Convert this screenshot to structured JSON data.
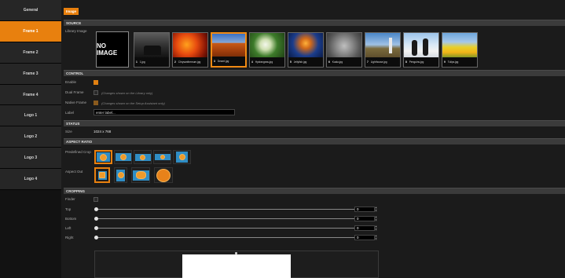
{
  "sidebar": {
    "items": [
      {
        "label": "General",
        "active": false
      },
      {
        "label": "Frame 1",
        "active": true
      },
      {
        "label": "Frame 2",
        "active": false
      },
      {
        "label": "Frame 3",
        "active": false
      },
      {
        "label": "Frame 4",
        "active": false
      },
      {
        "label": "Logo 1",
        "active": false
      },
      {
        "label": "Logo 2",
        "active": false
      },
      {
        "label": "Logo 3",
        "active": false
      },
      {
        "label": "Logo 4",
        "active": false
      }
    ]
  },
  "tab": {
    "label": "Image"
  },
  "source": {
    "header": "SOURCE",
    "library_label": "Library Image",
    "no_image": "NO IMAGE",
    "thumbs": [
      {
        "num": "1",
        "name": "1.jpg"
      },
      {
        "num": "2",
        "name": "Chrysanthemum.jpg"
      },
      {
        "num": "3",
        "name": "Desert.jpg"
      },
      {
        "num": "4",
        "name": "Hydrangeas.jpg"
      },
      {
        "num": "5",
        "name": "Jellyfish.jpg"
      },
      {
        "num": "6",
        "name": "Koala.jpg"
      },
      {
        "num": "7",
        "name": "Lighthouse.jpg"
      },
      {
        "num": "8",
        "name": "Penguins.jpg"
      },
      {
        "num": "9",
        "name": "Tulips.jpg"
      }
    ],
    "selected_index": 2
  },
  "control": {
    "header": "CONTROL",
    "enable_label": "Enable",
    "enable_checked": true,
    "dual_label": "Dual Frame",
    "dual_checked": false,
    "dual_hint": "(Changes shown on the Library only)",
    "native_label": "Native Frame",
    "native_checked": true,
    "native_hint": "(Changes shown on the Setup Assistant only)",
    "label_label": "Label",
    "label_value": "enter label..."
  },
  "status": {
    "header": "STATUS",
    "size_label": "Size",
    "size_value": "1024 x 768"
  },
  "aspect": {
    "header": "ASPECT RATIO",
    "predefined_label": "Predefined Crop",
    "predefined_selected": 0,
    "aspect_out_label": "Aspect Out",
    "aspect_out_selected": 0
  },
  "cropping": {
    "header": "CROPPING",
    "finder_label": "Finder",
    "finder_checked": false,
    "rows": [
      {
        "label": "Top",
        "value": "0"
      },
      {
        "label": "Bottom",
        "value": "0"
      },
      {
        "label": "Left",
        "value": "0"
      },
      {
        "label": "Right",
        "value": "0"
      }
    ]
  },
  "colors": {
    "accent": "#e8800e",
    "crop_blue": "#2f8dc4"
  }
}
